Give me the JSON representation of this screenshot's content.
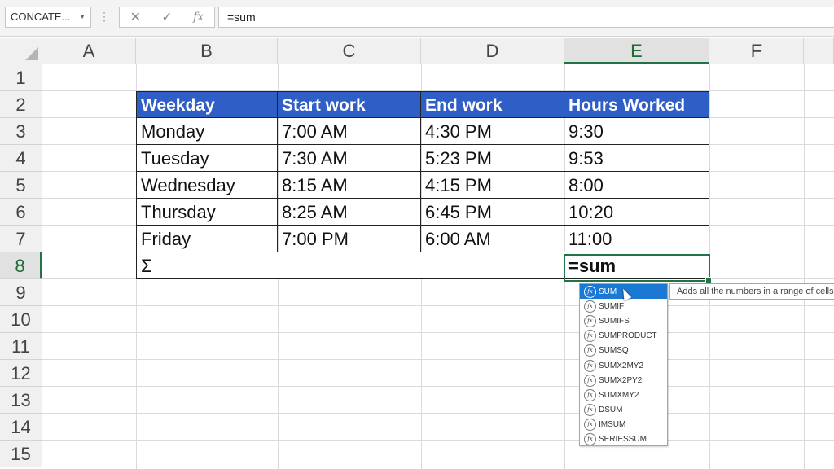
{
  "formula_bar": {
    "name_box": "CONCATE...",
    "name_box_caret": "▼",
    "dots": "⋮",
    "cancel_icon": "✕",
    "enter_icon": "✓",
    "fx_label": "fx",
    "formula": "=sum"
  },
  "columns": [
    "A",
    "B",
    "C",
    "D",
    "E",
    "F"
  ],
  "rows": [
    "1",
    "2",
    "3",
    "4",
    "5",
    "6",
    "7",
    "8",
    "9",
    "10",
    "11",
    "12",
    "13",
    "14",
    "15"
  ],
  "table": {
    "headers": [
      "Weekday",
      "Start work",
      "End work",
      "Hours Worked"
    ],
    "rows": [
      [
        "Monday",
        "7:00 AM",
        "4:30 PM",
        "9:30"
      ],
      [
        "Tuesday",
        "7:30 AM",
        "5:23 PM",
        "9:53"
      ],
      [
        "Wednesday",
        "8:15 AM",
        "4:15 PM",
        "8:00"
      ],
      [
        "Thursday",
        "8:25 AM",
        "6:45 PM",
        "10:20"
      ],
      [
        "Friday",
        "7:00 PM",
        "6:00 AM",
        "11:00"
      ]
    ],
    "sum_label": "Σ",
    "active_cell_value": "=sum"
  },
  "autocomplete": {
    "icon_label": "fx",
    "items": [
      "SUM",
      "SUMIF",
      "SUMIFS",
      "SUMPRODUCT",
      "SUMSQ",
      "SUMX2MY2",
      "SUMX2PY2",
      "SUMXMY2",
      "DSUM",
      "IMSUM",
      "SERIESSUM"
    ],
    "tooltip": "Adds all the numbers in a range of cells"
  },
  "colors": {
    "header_fill": "#2f5fc6",
    "selection_green": "#217346",
    "dropdown_highlight": "#1c79d3"
  }
}
